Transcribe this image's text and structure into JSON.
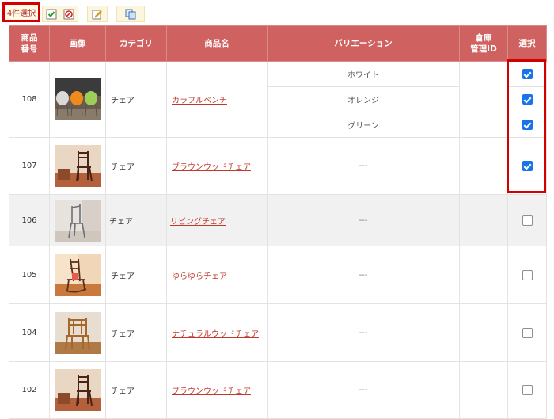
{
  "toolbar": {
    "selected_count_label": "4件選択",
    "buttons": [
      "check-all-icon",
      "uncheck-all-icon",
      "edit-icon",
      "copy-icon"
    ]
  },
  "table": {
    "headers": {
      "number": "商品\n番号",
      "image": "画像",
      "category": "カテゴリ",
      "name": "商品名",
      "variation": "バリエーション",
      "warehouse": "倉庫\n管理ID",
      "select": "選択"
    },
    "rows": [
      {
        "number": "108",
        "category": "チェア",
        "name": "カラフルベンチ",
        "variations": [
          "ホワイト",
          "オレンジ",
          "グリーン"
        ],
        "checked": [
          true,
          true,
          true
        ]
      },
      {
        "number": "107",
        "category": "チェア",
        "name": "ブラウンウッドチェア",
        "variations": [
          "---"
        ],
        "checked": [
          true
        ]
      },
      {
        "number": "106",
        "category": "チェア",
        "name": "リビングチェア",
        "variations": [
          "---"
        ],
        "checked": [
          false
        ]
      },
      {
        "number": "105",
        "category": "チェア",
        "name": "ゆらゆらチェア",
        "variations": [
          "---"
        ],
        "checked": [
          false
        ]
      },
      {
        "number": "104",
        "category": "チェア",
        "name": "ナチュラルウッドチェア",
        "variations": [
          "---"
        ],
        "checked": [
          false
        ]
      },
      {
        "number": "102",
        "category": "チェア",
        "name": "ブラウンウッドチェア",
        "variations": [
          "---"
        ],
        "checked": [
          false
        ]
      }
    ]
  },
  "colors": {
    "header_bg": "#cf6260",
    "link": "#c0392b",
    "highlight": "#d40000",
    "checkbox_on": "#1a73e8"
  }
}
